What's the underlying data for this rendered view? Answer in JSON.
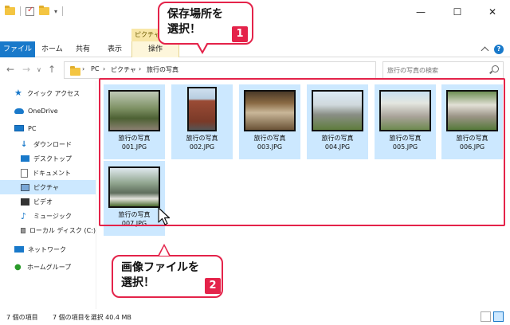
{
  "ribbon": {
    "context_group": "ピクチャ",
    "tabs": [
      {
        "label": "ファイル"
      },
      {
        "label": "ホーム"
      },
      {
        "label": "共有"
      },
      {
        "label": "表示"
      },
      {
        "label": "操作"
      }
    ]
  },
  "window": {
    "minimize": "—",
    "maximize": "☐",
    "close": "✕"
  },
  "address": {
    "crumbs": [
      "PC",
      "ピクチャ",
      "旅行の写真"
    ],
    "separator": "›"
  },
  "search": {
    "placeholder": "旅行の写真の検索"
  },
  "sidebar": {
    "items": [
      {
        "label": "クイック アクセス",
        "icon": "star-icon"
      },
      {
        "label": "OneDrive",
        "icon": "cloud-icon"
      },
      {
        "label": "PC",
        "icon": "computer-icon"
      },
      {
        "label": "ダウンロード",
        "icon": "download-icon"
      },
      {
        "label": "デスクトップ",
        "icon": "desktop-icon"
      },
      {
        "label": "ドキュメント",
        "icon": "document-icon"
      },
      {
        "label": "ピクチャ",
        "icon": "pictures-icon",
        "selected": true
      },
      {
        "label": "ビデオ",
        "icon": "video-icon"
      },
      {
        "label": "ミュージック",
        "icon": "music-icon"
      },
      {
        "label": "ローカル ディスク (C:)",
        "icon": "disk-icon"
      },
      {
        "label": "ネットワーク",
        "icon": "network-icon"
      },
      {
        "label": "ホームグループ",
        "icon": "homegroup-icon"
      }
    ]
  },
  "files": [
    {
      "name": "旅行の写真",
      "file": "001.JPG",
      "selected": true
    },
    {
      "name": "旅行の写真",
      "file": "002.JPG",
      "selected": true
    },
    {
      "name": "旅行の写真",
      "file": "003.JPG",
      "selected": true
    },
    {
      "name": "旅行の写真",
      "file": "004.JPG",
      "selected": true
    },
    {
      "name": "旅行の写真",
      "file": "005.JPG",
      "selected": true
    },
    {
      "name": "旅行の写真",
      "file": "006.JPG",
      "selected": true
    },
    {
      "name": "旅行の写真",
      "file": "007.JPG",
      "selected": true
    }
  ],
  "callouts": {
    "step1": {
      "line1": "保存場所を",
      "line2": "選択！",
      "badge": "1"
    },
    "step2": {
      "line1": "画像ファイルを",
      "line2": "選択！",
      "badge": "2"
    }
  },
  "status": {
    "count": "7 個の項目",
    "selection": "7 個の項目を選択 40.4 MB"
  },
  "colors": {
    "accent": "#1979ca",
    "selection": "#cce8ff",
    "callout_red": "#e4234a",
    "context_tab": "#f8e7a8"
  }
}
